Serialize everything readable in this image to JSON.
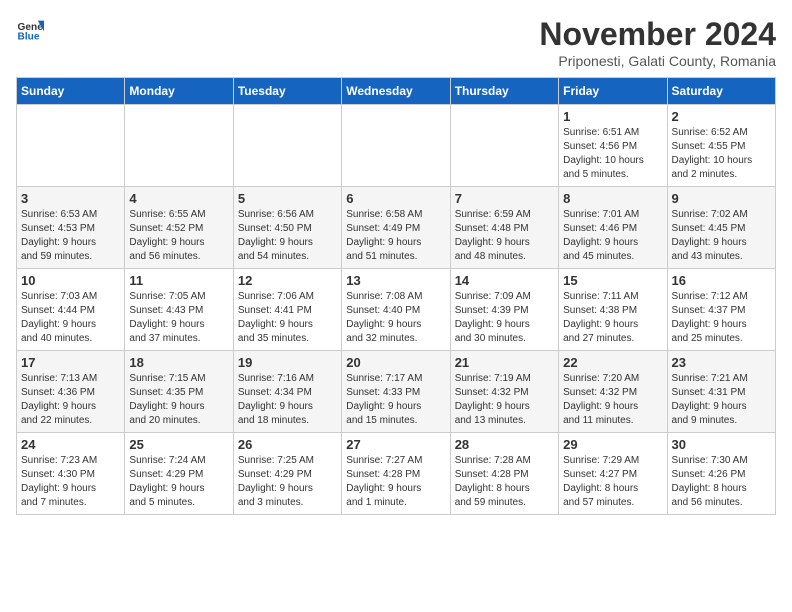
{
  "header": {
    "logo_general": "General",
    "logo_blue": "Blue",
    "month_title": "November 2024",
    "subtitle": "Priponesti, Galati County, Romania"
  },
  "days_of_week": [
    "Sunday",
    "Monday",
    "Tuesday",
    "Wednesday",
    "Thursday",
    "Friday",
    "Saturday"
  ],
  "weeks": [
    [
      {
        "day": "",
        "info": ""
      },
      {
        "day": "",
        "info": ""
      },
      {
        "day": "",
        "info": ""
      },
      {
        "day": "",
        "info": ""
      },
      {
        "day": "",
        "info": ""
      },
      {
        "day": "1",
        "info": "Sunrise: 6:51 AM\nSunset: 4:56 PM\nDaylight: 10 hours\nand 5 minutes."
      },
      {
        "day": "2",
        "info": "Sunrise: 6:52 AM\nSunset: 4:55 PM\nDaylight: 10 hours\nand 2 minutes."
      }
    ],
    [
      {
        "day": "3",
        "info": "Sunrise: 6:53 AM\nSunset: 4:53 PM\nDaylight: 9 hours\nand 59 minutes."
      },
      {
        "day": "4",
        "info": "Sunrise: 6:55 AM\nSunset: 4:52 PM\nDaylight: 9 hours\nand 56 minutes."
      },
      {
        "day": "5",
        "info": "Sunrise: 6:56 AM\nSunset: 4:50 PM\nDaylight: 9 hours\nand 54 minutes."
      },
      {
        "day": "6",
        "info": "Sunrise: 6:58 AM\nSunset: 4:49 PM\nDaylight: 9 hours\nand 51 minutes."
      },
      {
        "day": "7",
        "info": "Sunrise: 6:59 AM\nSunset: 4:48 PM\nDaylight: 9 hours\nand 48 minutes."
      },
      {
        "day": "8",
        "info": "Sunrise: 7:01 AM\nSunset: 4:46 PM\nDaylight: 9 hours\nand 45 minutes."
      },
      {
        "day": "9",
        "info": "Sunrise: 7:02 AM\nSunset: 4:45 PM\nDaylight: 9 hours\nand 43 minutes."
      }
    ],
    [
      {
        "day": "10",
        "info": "Sunrise: 7:03 AM\nSunset: 4:44 PM\nDaylight: 9 hours\nand 40 minutes."
      },
      {
        "day": "11",
        "info": "Sunrise: 7:05 AM\nSunset: 4:43 PM\nDaylight: 9 hours\nand 37 minutes."
      },
      {
        "day": "12",
        "info": "Sunrise: 7:06 AM\nSunset: 4:41 PM\nDaylight: 9 hours\nand 35 minutes."
      },
      {
        "day": "13",
        "info": "Sunrise: 7:08 AM\nSunset: 4:40 PM\nDaylight: 9 hours\nand 32 minutes."
      },
      {
        "day": "14",
        "info": "Sunrise: 7:09 AM\nSunset: 4:39 PM\nDaylight: 9 hours\nand 30 minutes."
      },
      {
        "day": "15",
        "info": "Sunrise: 7:11 AM\nSunset: 4:38 PM\nDaylight: 9 hours\nand 27 minutes."
      },
      {
        "day": "16",
        "info": "Sunrise: 7:12 AM\nSunset: 4:37 PM\nDaylight: 9 hours\nand 25 minutes."
      }
    ],
    [
      {
        "day": "17",
        "info": "Sunrise: 7:13 AM\nSunset: 4:36 PM\nDaylight: 9 hours\nand 22 minutes."
      },
      {
        "day": "18",
        "info": "Sunrise: 7:15 AM\nSunset: 4:35 PM\nDaylight: 9 hours\nand 20 minutes."
      },
      {
        "day": "19",
        "info": "Sunrise: 7:16 AM\nSunset: 4:34 PM\nDaylight: 9 hours\nand 18 minutes."
      },
      {
        "day": "20",
        "info": "Sunrise: 7:17 AM\nSunset: 4:33 PM\nDaylight: 9 hours\nand 15 minutes."
      },
      {
        "day": "21",
        "info": "Sunrise: 7:19 AM\nSunset: 4:32 PM\nDaylight: 9 hours\nand 13 minutes."
      },
      {
        "day": "22",
        "info": "Sunrise: 7:20 AM\nSunset: 4:32 PM\nDaylight: 9 hours\nand 11 minutes."
      },
      {
        "day": "23",
        "info": "Sunrise: 7:21 AM\nSunset: 4:31 PM\nDaylight: 9 hours\nand 9 minutes."
      }
    ],
    [
      {
        "day": "24",
        "info": "Sunrise: 7:23 AM\nSunset: 4:30 PM\nDaylight: 9 hours\nand 7 minutes."
      },
      {
        "day": "25",
        "info": "Sunrise: 7:24 AM\nSunset: 4:29 PM\nDaylight: 9 hours\nand 5 minutes."
      },
      {
        "day": "26",
        "info": "Sunrise: 7:25 AM\nSunset: 4:29 PM\nDaylight: 9 hours\nand 3 minutes."
      },
      {
        "day": "27",
        "info": "Sunrise: 7:27 AM\nSunset: 4:28 PM\nDaylight: 9 hours\nand 1 minute."
      },
      {
        "day": "28",
        "info": "Sunrise: 7:28 AM\nSunset: 4:28 PM\nDaylight: 8 hours\nand 59 minutes."
      },
      {
        "day": "29",
        "info": "Sunrise: 7:29 AM\nSunset: 4:27 PM\nDaylight: 8 hours\nand 57 minutes."
      },
      {
        "day": "30",
        "info": "Sunrise: 7:30 AM\nSunset: 4:26 PM\nDaylight: 8 hours\nand 56 minutes."
      }
    ]
  ]
}
